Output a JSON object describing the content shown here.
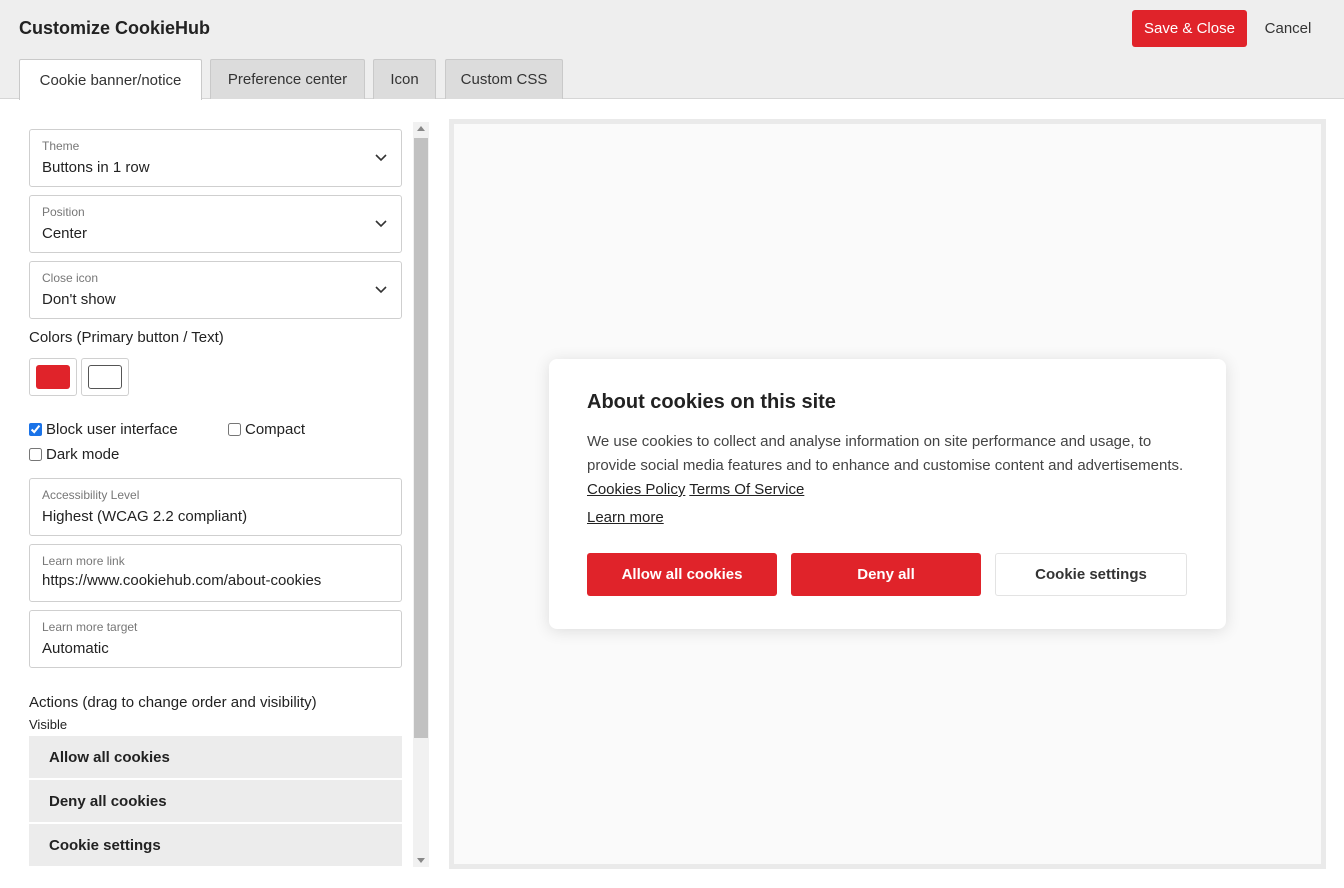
{
  "header": {
    "title": "Customize CookieHub",
    "save_label": "Save & Close",
    "cancel_label": "Cancel"
  },
  "tabs": [
    {
      "label": "Cookie banner/notice",
      "active": true
    },
    {
      "label": "Preference center",
      "active": false
    },
    {
      "label": "Icon",
      "active": false
    },
    {
      "label": "Custom CSS",
      "active": false
    }
  ],
  "settings": {
    "theme": {
      "label": "Theme",
      "value": "Buttons in 1 row"
    },
    "position": {
      "label": "Position",
      "value": "Center"
    },
    "close_icon": {
      "label": "Close icon",
      "value": "Don't show"
    },
    "colors_label": "Colors (Primary button / Text)",
    "primary_color": "#e0232a",
    "text_color": "#ffffff",
    "block_ui": {
      "label": "Block user interface",
      "checked": true
    },
    "compact": {
      "label": "Compact",
      "checked": false
    },
    "dark_mode": {
      "label": "Dark mode",
      "checked": false
    },
    "accessibility": {
      "label": "Accessibility Level",
      "value": "Highest (WCAG 2.2 compliant)"
    },
    "learn_more_link": {
      "label": "Learn more link",
      "value": "https://www.cookiehub.com/about-cookies"
    },
    "learn_more_target": {
      "label": "Learn more target",
      "value": "Automatic"
    },
    "actions_label": "Actions (drag to change order and visibility)",
    "visible_label": "Visible",
    "actions": [
      "Allow all cookies",
      "Deny all cookies",
      "Cookie settings"
    ]
  },
  "preview": {
    "title": "About cookies on this site",
    "text": "We use cookies to collect and analyse information on site performance and usage, to provide social media features and to enhance and customise content and advertisements.",
    "link_policy": "Cookies Policy",
    "link_terms": "Terms Of Service",
    "learn_more": "Learn more",
    "btn_allow": "Allow all cookies",
    "btn_deny": "Deny all",
    "btn_settings": "Cookie settings"
  }
}
